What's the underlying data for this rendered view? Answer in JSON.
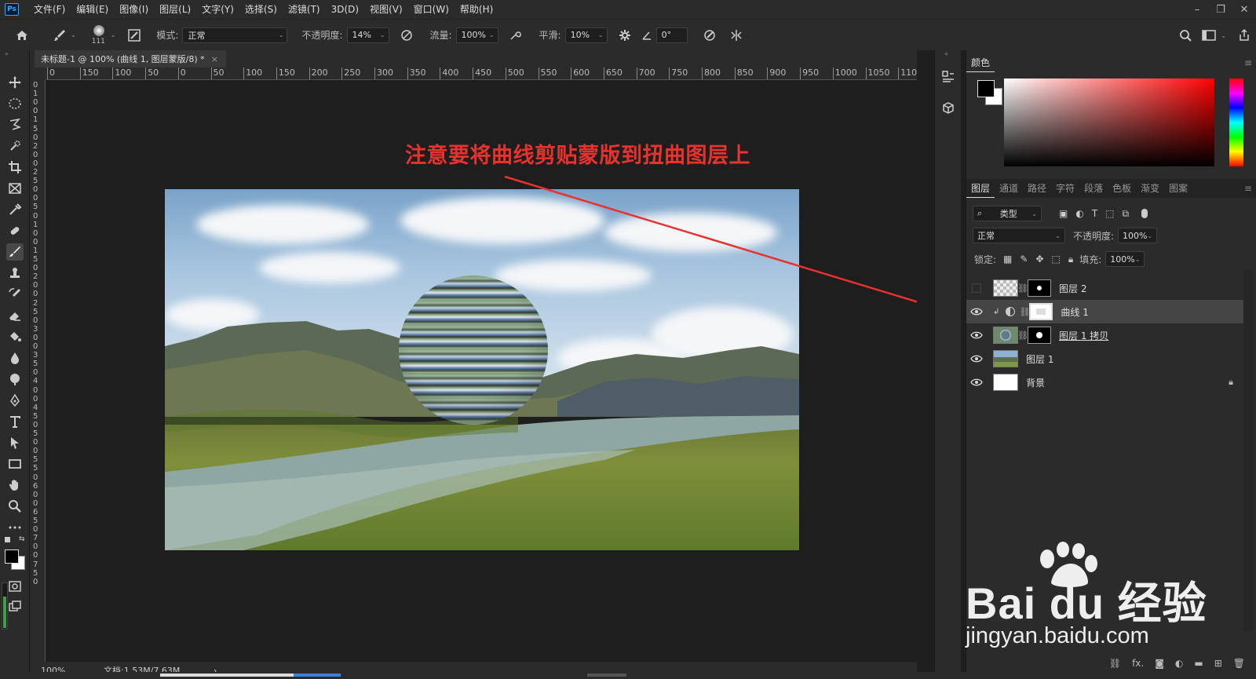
{
  "app": {
    "logo": "Ps"
  },
  "menu": [
    "文件(F)",
    "编辑(E)",
    "图像(I)",
    "图层(L)",
    "文字(Y)",
    "选择(S)",
    "滤镜(T)",
    "3D(D)",
    "视图(V)",
    "窗口(W)",
    "帮助(H)"
  ],
  "window": {
    "minimize": "–",
    "restore": "❐",
    "close": "✕"
  },
  "options": {
    "brush_size": "111",
    "mode_label": "模式:",
    "mode_value": "正常",
    "opacity_label": "不透明度:",
    "opacity_value": "14%",
    "flow_label": "流量:",
    "flow_value": "100%",
    "smooth_label": "平滑:",
    "smooth_value": "10%",
    "angle_value": "0°"
  },
  "document": {
    "tab_title": "未标题-1 @ 100% (曲线 1, 图层蒙版/8) *",
    "close": "×",
    "zoom": "100%",
    "doc_info": "文档:1.53M/7.63M",
    "arrow": "›"
  },
  "ruler_h": [
    "0",
    "150",
    "100",
    "50",
    "0",
    "50",
    "100",
    "150",
    "200",
    "250",
    "300",
    "350",
    "400",
    "450",
    "500",
    "550",
    "600",
    "650",
    "700",
    "750",
    "800",
    "850",
    "900",
    "950",
    "1000",
    "1050",
    "1100"
  ],
  "ruler_v": [
    "0",
    "1",
    "0",
    "0",
    "1",
    "5",
    "0",
    "2",
    "0",
    "0",
    "2",
    "5",
    "0",
    "0",
    "5",
    "0",
    "1",
    "0",
    "0",
    "1",
    "5",
    "0",
    "2",
    "0",
    "0",
    "2",
    "5",
    "0",
    "3",
    "0",
    "0",
    "3",
    "5",
    "0",
    "4",
    "0",
    "0",
    "4",
    "5",
    "0",
    "5",
    "0",
    "0",
    "5",
    "5",
    "0",
    "6",
    "0",
    "0",
    "6",
    "5",
    "0",
    "7",
    "0",
    "0",
    "7",
    "5",
    "0"
  ],
  "annotation": "注意要将曲线剪贴蒙版到扭曲图层上",
  "panels": {
    "color_title": "颜色",
    "tabs": [
      "图层",
      "通道",
      "路径",
      "字符",
      "段落",
      "色板",
      "渐变",
      "图案"
    ],
    "filter_label": "类型",
    "blend_mode": "正常",
    "opacity_label": "不透明度:",
    "opacity_value": "100%",
    "lock_label": "锁定:",
    "fill_label": "填充:",
    "fill_value": "100%"
  },
  "layers": [
    {
      "name": "图层 2",
      "visible": false
    },
    {
      "name": "曲线 1",
      "visible": true,
      "selected": true
    },
    {
      "name": "图层 1 拷贝",
      "visible": true
    },
    {
      "name": "图层 1",
      "visible": true
    },
    {
      "name": "背景",
      "visible": true,
      "locked": true
    }
  ],
  "panel_bottom": [
    "fx."
  ],
  "watermark": {
    "brand": "Bai du 经验",
    "url": "jingyan.baidu.com"
  },
  "colors": {
    "annotation": "#e8322e",
    "arrow": "#e8322e",
    "bg": "#1e1e1e",
    "panel": "#2b2b2b"
  }
}
